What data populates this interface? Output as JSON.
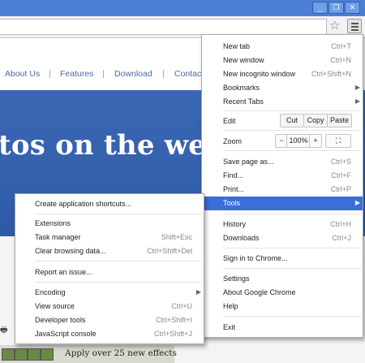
{
  "window": {
    "buttons": [
      "_",
      "❐",
      "✕"
    ]
  },
  "toolbar": {
    "star": "☆"
  },
  "page": {
    "nav": [
      "About Us",
      "Features",
      "Download",
      "Contac"
    ],
    "nav_sep": "|",
    "hero_title": "tos on the web",
    "effects_text": "Apply over 25 new effects"
  },
  "menu": {
    "new_tab": {
      "label": "New tab",
      "shortcut": "Ctrl+T"
    },
    "new_window": {
      "label": "New window",
      "shortcut": "Ctrl+N"
    },
    "new_incognito": {
      "label": "New incognito window",
      "shortcut": "Ctrl+Shift+N"
    },
    "bookmarks": {
      "label": "Bookmarks"
    },
    "recent_tabs": {
      "label": "Recent Tabs"
    },
    "edit": {
      "label": "Edit",
      "cut": "Cut",
      "copy": "Copy",
      "paste": "Paste"
    },
    "zoom": {
      "label": "Zoom",
      "minus": "−",
      "value": "100%",
      "plus": "+",
      "fullscreen": "⛶"
    },
    "save_page": {
      "label": "Save page as...",
      "shortcut": "Ctrl+S"
    },
    "find": {
      "label": "Find...",
      "shortcut": "Ctrl+F"
    },
    "print": {
      "label": "Print...",
      "shortcut": "Ctrl+P"
    },
    "tools": {
      "label": "Tools"
    },
    "history": {
      "label": "History",
      "shortcut": "Ctrl+H"
    },
    "downloads": {
      "label": "Downloads",
      "shortcut": "Ctrl+J"
    },
    "signin": {
      "label": "Sign in to Chrome..."
    },
    "settings": {
      "label": "Settings"
    },
    "about": {
      "label": "About Google Chrome"
    },
    "help": {
      "label": "Help"
    },
    "exit": {
      "label": "Exit"
    },
    "submenu_arrow": "▶"
  },
  "tools_menu": {
    "create_shortcuts": {
      "label": "Create application shortcuts..."
    },
    "extensions": {
      "label": "Extensions"
    },
    "task_manager": {
      "label": "Task manager",
      "shortcut": "Shift+Esc"
    },
    "clear_browsing": {
      "label": "Clear browsing data...",
      "shortcut": "Ctrl+Shift+Del"
    },
    "report_issue": {
      "label": "Report an issue..."
    },
    "encoding": {
      "label": "Encoding"
    },
    "view_source": {
      "label": "View source",
      "shortcut": "Ctrl+U"
    },
    "developer_tools": {
      "label": "Developer tools",
      "shortcut": "Ctrl+Shift+I"
    },
    "js_console": {
      "label": "JavaScript console",
      "shortcut": "Ctrl+Shift+J"
    }
  }
}
